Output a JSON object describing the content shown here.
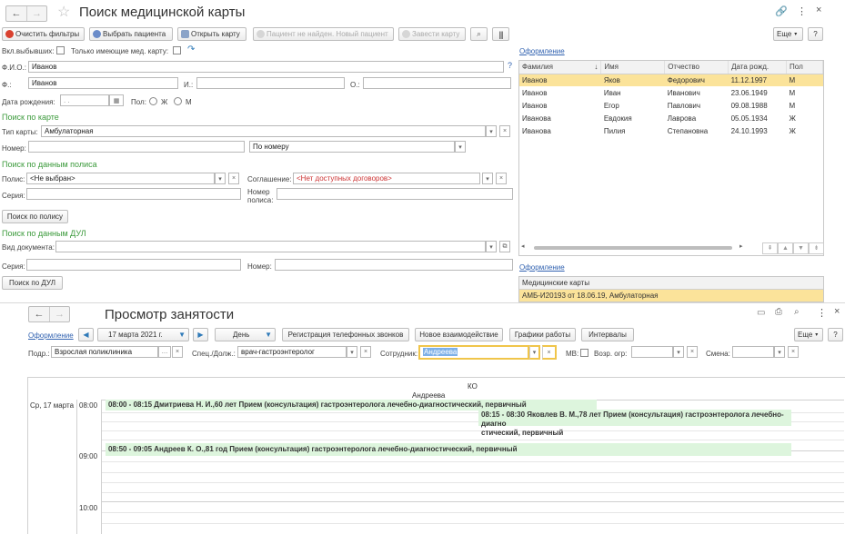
{
  "top_window": {
    "title": "Поиск медицинской карты",
    "nav_back": "←",
    "nav_forward": "→",
    "star": "☆",
    "header_icons": [
      "link-icon",
      "more-icon",
      "close-icon"
    ],
    "toolbar": {
      "clear_filters": "Очистить фильтры",
      "choose_patient": "Выбрать пациента",
      "open_card": "Открыть карту",
      "not_found": "Пациент не найден. Новый пациент",
      "create_card": "Завести карту",
      "more": "Еще",
      "help": "?"
    },
    "filters": {
      "include_dropouts": "Вкл.выбывших:",
      "only_with_card": "Только имеющие мед. карту:",
      "fio_label": "Ф.И.О.:",
      "fio_value": "Иванов",
      "fio_help": "?",
      "f_label": "Ф.:",
      "f_value": "Иванов",
      "i_label": "И.:",
      "o_label": "О.:",
      "birth_label": "Дата рождения:",
      "birth_placeholder": " .  .",
      "sex_label": "Пол:",
      "sex_f": "Ж",
      "sex_m": "М"
    },
    "card_search": {
      "section": "Поиск по  карте",
      "type_label": "Тип карты:",
      "type_value": "Амбулаторная",
      "number_label": "Номер:",
      "number_mode": "По номеру"
    },
    "policy_search": {
      "section": "Поиск по данным полиса",
      "policy_label": "Полис:",
      "policy_value": "<Не выбран>",
      "agreement_label": "Соглашение:",
      "agreement_value": "<Нет доступных договоров>",
      "series_label": "Серия:",
      "number_label_1": "Номер",
      "number_label_2": "полиса:",
      "button": "Поиск по полису"
    },
    "doc_search": {
      "section": "Поиск по данным ДУЛ",
      "doc_type_label": "Вид документа:",
      "series_label": "Серия:",
      "number_label": "Номер:",
      "button": "Поиск по ДУЛ"
    },
    "results": {
      "design_link": "Оформление",
      "columns": [
        "Фамилия",
        "Имя",
        "Отчество",
        "Дата рожд.",
        "Пол"
      ],
      "sort_arrow": "↓",
      "rows": [
        [
          "Иванов",
          "Яков",
          "Федорович",
          "11.12.1997",
          "М"
        ],
        [
          "Иванов",
          "Иван",
          "Иванович",
          "23.06.1949",
          "М"
        ],
        [
          "Иванов",
          "Егор",
          "Павлович",
          "09.08.1988",
          "М"
        ],
        [
          "Иванова",
          "Евдокия",
          "Лаврова",
          "05.05.1934",
          "Ж"
        ],
        [
          "Иванова",
          "Пилия",
          "Степановна",
          "24.10.1993",
          "Ж"
        ]
      ],
      "selected_row": 0
    },
    "cards": {
      "design_link": "Оформление",
      "header": "Медицинские карты",
      "row": "АМБ-И20193 от 18.06.19, Амбулаторная"
    }
  },
  "bottom_window": {
    "title": "Просмотр занятости",
    "nav_back": "←",
    "nav_forward": "→",
    "design_link": "Оформление",
    "date_value": "17 марта 2021 г.",
    "period_value": "День",
    "buttons": {
      "calls": "Регистрация телефонных звонков",
      "new_interaction": "Новое взаимодействие",
      "schedules": "Графики работы",
      "intervals": "Интервалы",
      "more": "Еще",
      "help": "?"
    },
    "filters": {
      "dept_label": "Подр.:",
      "dept_value": "Взрослая поликлиника",
      "spec_label": "Спец./Долж.:",
      "spec_value": "врач-гастроэнтеролог",
      "emp_label": "Сотрудник:",
      "emp_value": "Андреева",
      "mv_label": "МВ:",
      "age_label": "Возр. огр:",
      "shift_label": "Смена:"
    },
    "schedule": {
      "cabinet": "КО",
      "doctor": "Андреева",
      "day_label": "Ср, 17 марта",
      "times": [
        "08:00",
        "09:00",
        "10:00"
      ],
      "appointments": [
        "08:00 - 08:15 Дмитриева Н. И.,60 лет Прием (консультация) гастроэнтеролога лечебно-диагностический, первичный",
        "08:15 - 08:30 Яковлев В. М.,78 лет Прием (консультация) гастроэнтеролога лечебно-диагно",
        "стический, первичный",
        "08:50 - 09:05 Андреев К. О.,81 год Прием (консультация) гастроэнтеролога лечебно-диагностический, первичный"
      ]
    }
  }
}
